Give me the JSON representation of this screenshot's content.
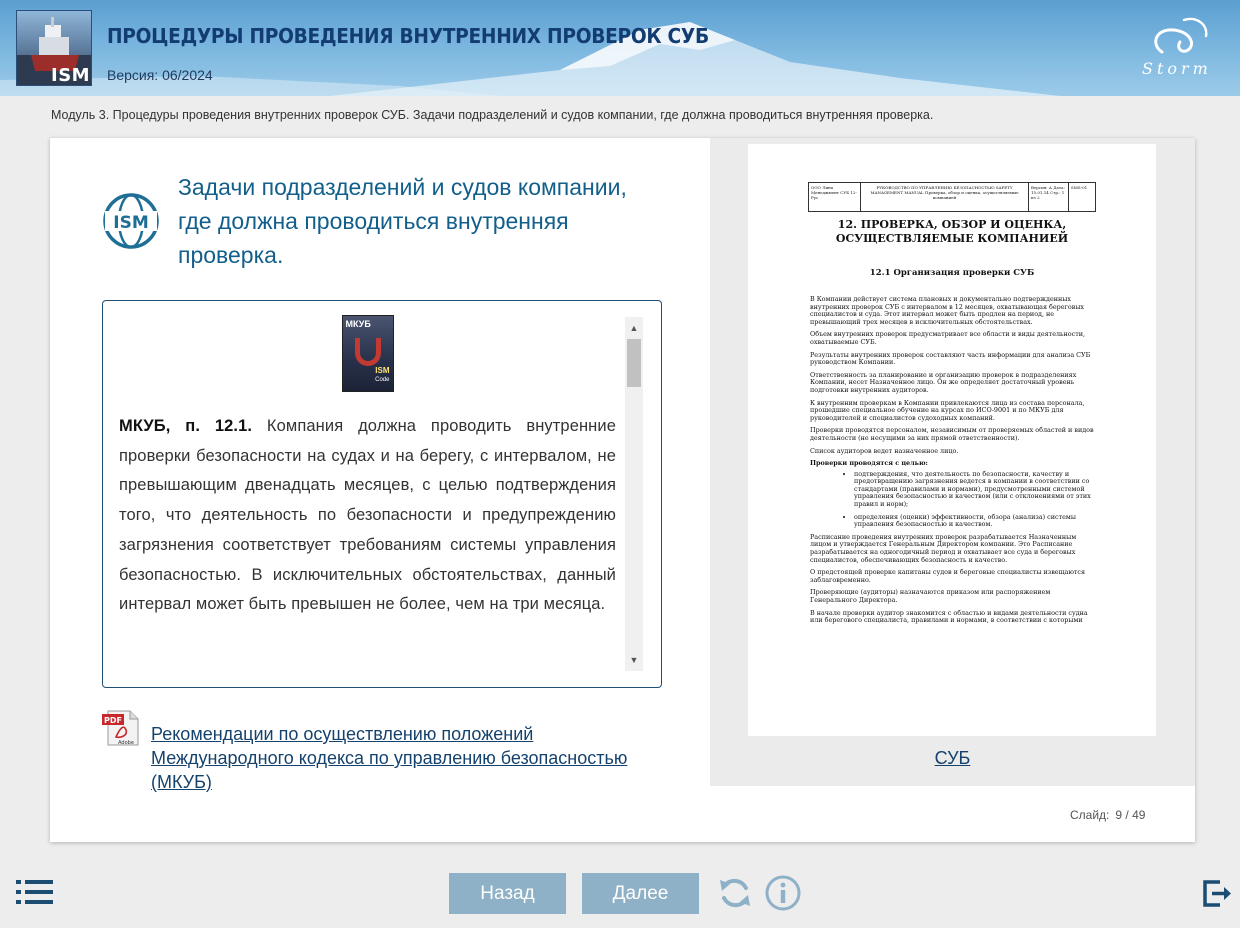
{
  "header": {
    "course_title": "ПРОЦЕДУРЫ ПРОВЕДЕНИЯ ВНУТРЕННИХ ПРОВЕРОК СУБ",
    "version": "Версия: 06/2024",
    "logo_thumb_text": "ISM",
    "brand_text": "Storm"
  },
  "breadcrumb": "Модуль 3. Процедуры проведения внутренних проверок СУБ. Задачи подразделений и судов компании, где должна проводиться внутренняя проверка.",
  "slide": {
    "badge_text": "ISM",
    "title": "Задачи подразделений и судов компании, где должна проводиться внутренняя проверка.",
    "book_cover": {
      "title": "МКУБ",
      "line1": "ISM",
      "line2": "Code"
    },
    "card_text_bold": "МКУБ, п. 12.1.",
    "card_text": " Компания должна проводить внутренние проверки безопасности на судах и на берегу, с интервалом, не превышающим двенадцать месяцев, с целью подтверждения того, что деятельность по безопасности и предупреждению загрязнения соответствует требованиям системы управления безопасностью. В исключительных обстоятельствах, данный интервал может быть превышен не более, чем на три месяца.",
    "pdf_link": "Рекомендации по осуществлению положений Международного кодекса по управлению безопасностью (МКУБ)",
    "pdf_icon_label": "PDF",
    "pdf_icon_sub": "Adobe",
    "document": {
      "header": {
        "c1": "ООО Лина Менеджмент СУБ 12-Рус",
        "c2": "РУКОВОДСТВО ПО УПРАВЛЕНИЮ БЕЗОПАСНОСТЬЮ SAFETY MANAGEMENT MANUAL Проверка, обзор и оценка, осуществляемые компанией",
        "c3": "Версия: А Дата: 15.01.14 Стр.: 1 из 2",
        "c4": "SMS-01"
      },
      "heading": "12. ПРОВЕРКА, ОБЗОР И ОЦЕНКА, ОСУЩЕСТВЛЯЕМЫЕ КОМПАНИЕЙ",
      "subheading": "12.1 Организация проверки СУБ",
      "paragraphs": [
        "В Компании действует система плановых и документально подтвержденных внутренних проверок СУБ с интервалом в 12 месяцев, охватывающая береговых специалистов и суда. Этот интервал может быть продлен на период, не превышающий трех месяцев в исключительных обстоятельствах.",
        "Объем внутренних проверок предусматривает все области и виды деятельности, охватываемые СУБ.",
        "Результаты внутренних проверок составляют часть информации для анализа СУБ руководством Компании.",
        "Ответственность за планирование и организацию проверок в подразделениях Компании, несет Назначенное лицо. Он же определяет достаточный уровень подготовки внутренних аудиторов.",
        "К внутренним проверкам в Компании привлекаются лица из состава персонала, прошедшие специальное обучение на курсах по ИСО-9001 и по МКУБ для руководителей и специалистов судоходных компаний.",
        "Проверки проводятся персоналом, независимым от проверяемых областей и видов деятельности (не несущими за них прямой ответственности).",
        "Список аудиторов ведет назначенное лицо."
      ],
      "list_heading": "Проверки проводятся с целью:",
      "list_items": [
        "подтверждения, что деятельность по безопасности, качеству и предотвращению загрязнения ведется в компании в соответствии со стандартами (правилами и нормами), предусмотренными системой управления безопасностью и качеством (или с отклонениями от этих правил и норм);",
        "определения (оценки) эффективности, обзора (анализа) системы управления безопасностью и качеством."
      ],
      "paragraphs_after": [
        "Расписание проведения внутренних проверок разрабатывается Назначенным лицом и утверждается Генеральным Директором компании. Это Расписание разрабатывается на одногодичный период и охватывает все суда и береговых специалистов, обеспечивающих безопасность и качество.",
        "О предстоящей проверке капитаны судов и береговые специалисты извещаются заблаговременно.",
        "Проверяющие (аудиторы) назначаются приказом или распоряжением Генерального Директора.",
        "В начале проверки аудитор знакомится с областью и видами деятельности судна или берегового специалиста, правилами и нормами, в соответствии с которыми"
      ]
    },
    "doc_caption": "СУБ",
    "counter_label": "Слайд:",
    "counter_value": "9 / 49"
  },
  "footer": {
    "back_label": "Назад",
    "next_label": "Далее"
  },
  "colors": {
    "accent": "#135f8b",
    "title_dark": "#123c72",
    "button": "#8fb1c7",
    "icon": "#1b4d73",
    "link": "#15426c"
  }
}
